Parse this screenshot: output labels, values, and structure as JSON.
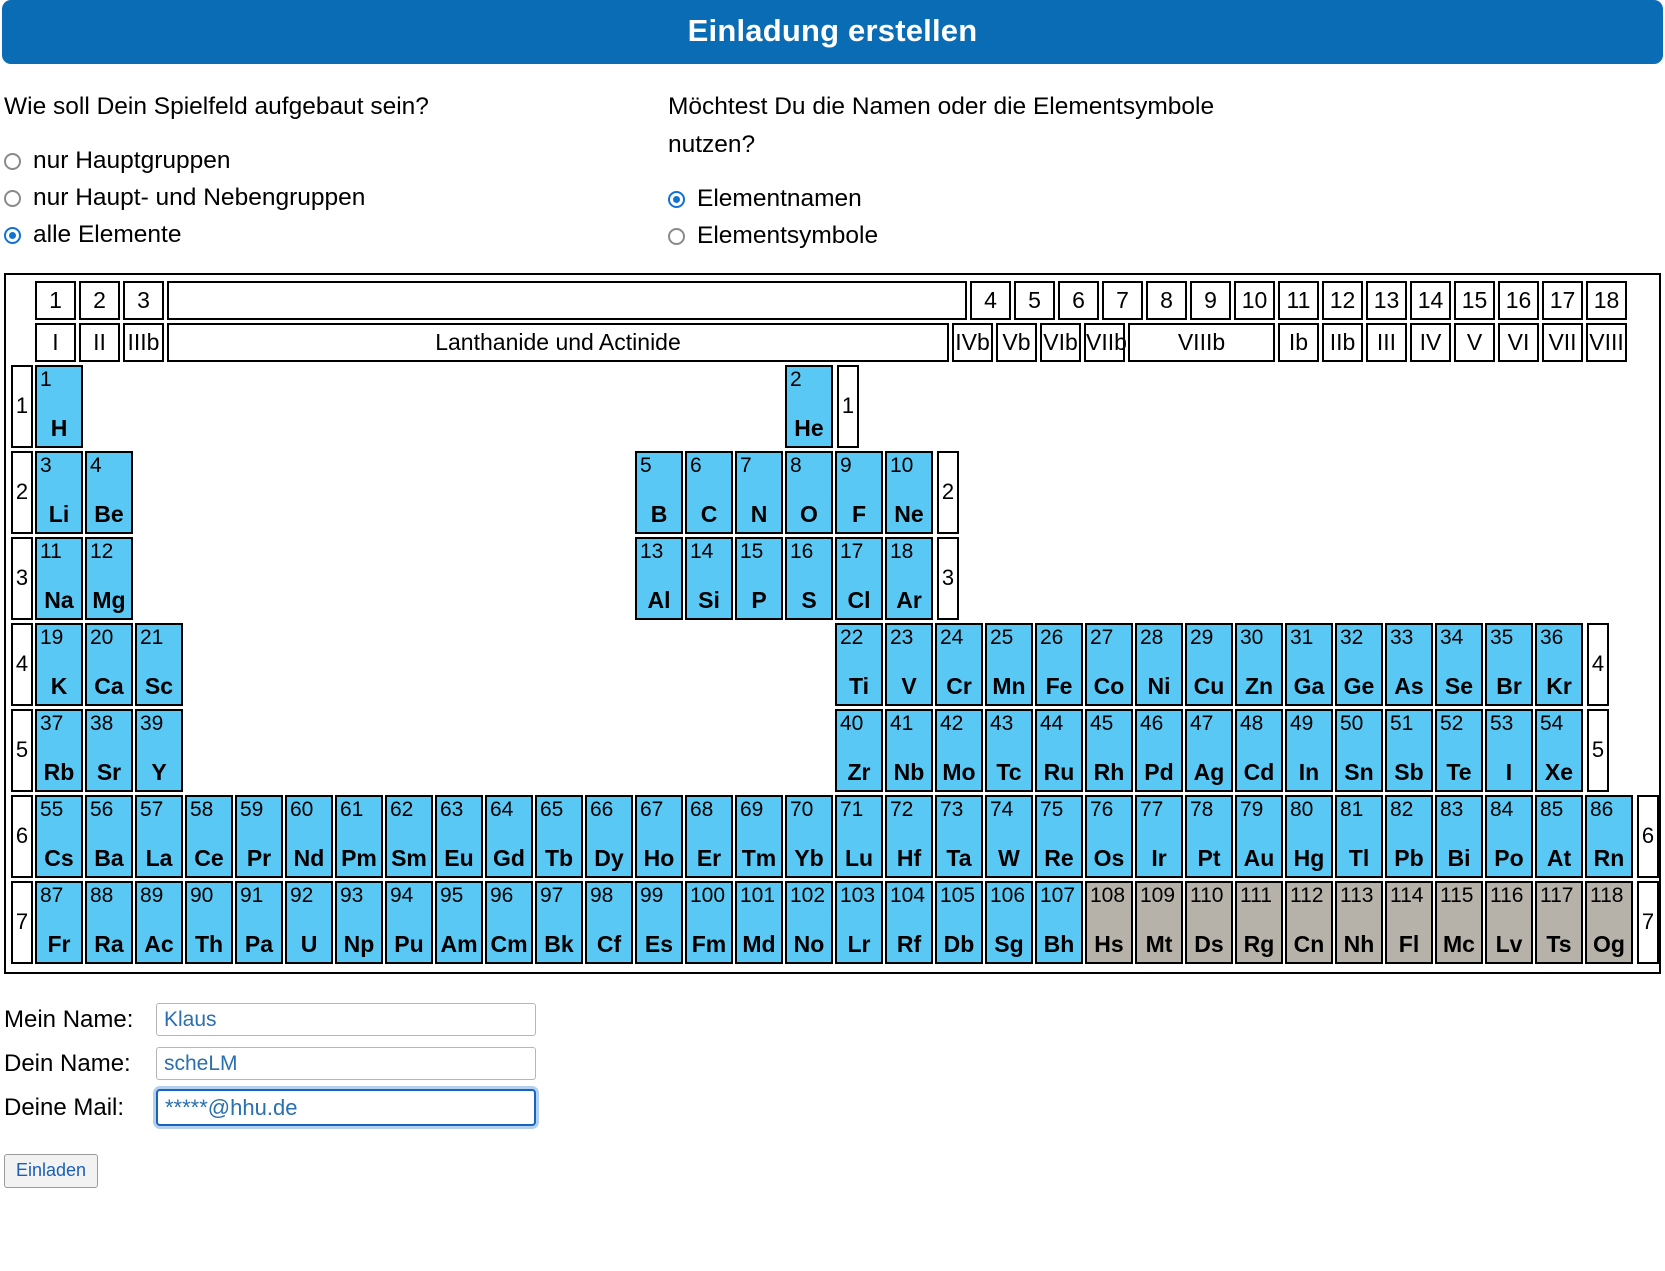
{
  "header": {
    "title": "Einladung erstellen",
    "accent": "#0a6cb4"
  },
  "questions": {
    "layout": {
      "prompt": "Wie soll Dein Spielfeld aufgebaut sein?",
      "options": [
        {
          "label": "nur Hauptgruppen",
          "selected": false
        },
        {
          "label": "nur Haupt- und Nebengruppen",
          "selected": false
        },
        {
          "label": "alle Elemente",
          "selected": true
        }
      ]
    },
    "naming": {
      "prompt": "Möchtest Du die Namen oder die Elementsymbole nutzen?",
      "options": [
        {
          "label": "Elementnamen",
          "selected": true
        },
        {
          "label": "Elementsymbole",
          "selected": false
        }
      ]
    }
  },
  "periodic_table": {
    "colors": {
      "element": "#5ac8f5",
      "disabled": "#b6b2aa",
      "border": "#000000"
    },
    "group_numbers_left": [
      "1",
      "2",
      "3"
    ],
    "group_numbers_right": [
      "4",
      "5",
      "6",
      "7",
      "8",
      "9",
      "10",
      "11",
      "12",
      "13",
      "14",
      "15",
      "16",
      "17",
      "18"
    ],
    "roman_left": [
      "I",
      "II",
      "IIIb"
    ],
    "lanthanide_label": "Lanthanide und Actinide",
    "roman_right": [
      "IVb",
      "Vb",
      "VIb",
      "VIIb",
      "VIIIb",
      "Ib",
      "IIb",
      "III",
      "IV",
      "V",
      "VI",
      "VII",
      "VIII"
    ],
    "period_labels": [
      "1",
      "2",
      "3",
      "4",
      "5",
      "6",
      "7"
    ],
    "rows": [
      {
        "period": "1",
        "left": [
          {
            "n": "1",
            "s": "H"
          }
        ],
        "gap": 14,
        "right": [
          {
            "n": "2",
            "s": "He"
          }
        ]
      },
      {
        "period": "2",
        "left": [
          {
            "n": "3",
            "s": "Li"
          },
          {
            "n": "4",
            "s": "Be"
          }
        ],
        "gap": 10,
        "right": [
          {
            "n": "5",
            "s": "B"
          },
          {
            "n": "6",
            "s": "C"
          },
          {
            "n": "7",
            "s": "N"
          },
          {
            "n": "8",
            "s": "O"
          },
          {
            "n": "9",
            "s": "F"
          },
          {
            "n": "10",
            "s": "Ne"
          }
        ]
      },
      {
        "period": "3",
        "left": [
          {
            "n": "11",
            "s": "Na"
          },
          {
            "n": "12",
            "s": "Mg"
          }
        ],
        "gap": 10,
        "right": [
          {
            "n": "13",
            "s": "Al"
          },
          {
            "n": "14",
            "s": "Si"
          },
          {
            "n": "15",
            "s": "P"
          },
          {
            "n": "16",
            "s": "S"
          },
          {
            "n": "17",
            "s": "Cl"
          },
          {
            "n": "18",
            "s": "Ar"
          }
        ]
      },
      {
        "period": "4",
        "left": [
          {
            "n": "19",
            "s": "K"
          },
          {
            "n": "20",
            "s": "Ca"
          },
          {
            "n": "21",
            "s": "Sc"
          }
        ],
        "gap": 13,
        "right": [
          {
            "n": "22",
            "s": "Ti"
          },
          {
            "n": "23",
            "s": "V"
          },
          {
            "n": "24",
            "s": "Cr"
          },
          {
            "n": "25",
            "s": "Mn"
          },
          {
            "n": "26",
            "s": "Fe"
          },
          {
            "n": "27",
            "s": "Co"
          },
          {
            "n": "28",
            "s": "Ni"
          },
          {
            "n": "29",
            "s": "Cu"
          },
          {
            "n": "30",
            "s": "Zn"
          },
          {
            "n": "31",
            "s": "Ga"
          },
          {
            "n": "32",
            "s": "Ge"
          },
          {
            "n": "33",
            "s": "As"
          },
          {
            "n": "34",
            "s": "Se"
          },
          {
            "n": "35",
            "s": "Br"
          },
          {
            "n": "36",
            "s": "Kr"
          }
        ]
      },
      {
        "period": "5",
        "left": [
          {
            "n": "37",
            "s": "Rb"
          },
          {
            "n": "38",
            "s": "Sr"
          },
          {
            "n": "39",
            "s": "Y"
          }
        ],
        "gap": 13,
        "right": [
          {
            "n": "40",
            "s": "Zr"
          },
          {
            "n": "41",
            "s": "Nb"
          },
          {
            "n": "42",
            "s": "Mo"
          },
          {
            "n": "43",
            "s": "Tc"
          },
          {
            "n": "44",
            "s": "Ru"
          },
          {
            "n": "45",
            "s": "Rh"
          },
          {
            "n": "46",
            "s": "Pd"
          },
          {
            "n": "47",
            "s": "Ag"
          },
          {
            "n": "48",
            "s": "Cd"
          },
          {
            "n": "49",
            "s": "In"
          },
          {
            "n": "50",
            "s": "Sn"
          },
          {
            "n": "51",
            "s": "Sb"
          },
          {
            "n": "52",
            "s": "Te"
          },
          {
            "n": "53",
            "s": "I"
          },
          {
            "n": "54",
            "s": "Xe"
          }
        ]
      },
      {
        "period": "6",
        "left": [
          {
            "n": "55",
            "s": "Cs"
          },
          {
            "n": "56",
            "s": "Ba"
          },
          {
            "n": "57",
            "s": "La"
          },
          {
            "n": "58",
            "s": "Ce"
          },
          {
            "n": "59",
            "s": "Pr"
          },
          {
            "n": "60",
            "s": "Nd"
          },
          {
            "n": "61",
            "s": "Pm"
          },
          {
            "n": "62",
            "s": "Sm"
          },
          {
            "n": "63",
            "s": "Eu"
          },
          {
            "n": "64",
            "s": "Gd"
          },
          {
            "n": "65",
            "s": "Tb"
          },
          {
            "n": "66",
            "s": "Dy"
          },
          {
            "n": "67",
            "s": "Ho"
          },
          {
            "n": "68",
            "s": "Er"
          },
          {
            "n": "69",
            "s": "Tm"
          },
          {
            "n": "70",
            "s": "Yb"
          },
          {
            "n": "71",
            "s": "Lu"
          }
        ],
        "gap": 0,
        "right": [
          {
            "n": "72",
            "s": "Hf"
          },
          {
            "n": "73",
            "s": "Ta"
          },
          {
            "n": "74",
            "s": "W"
          },
          {
            "n": "75",
            "s": "Re"
          },
          {
            "n": "76",
            "s": "Os"
          },
          {
            "n": "77",
            "s": "Ir"
          },
          {
            "n": "78",
            "s": "Pt"
          },
          {
            "n": "79",
            "s": "Au"
          },
          {
            "n": "80",
            "s": "Hg"
          },
          {
            "n": "81",
            "s": "Tl"
          },
          {
            "n": "82",
            "s": "Pb"
          },
          {
            "n": "83",
            "s": "Bi"
          },
          {
            "n": "84",
            "s": "Po"
          },
          {
            "n": "85",
            "s": "At"
          },
          {
            "n": "86",
            "s": "Rn"
          }
        ]
      },
      {
        "period": "7",
        "left": [
          {
            "n": "87",
            "s": "Fr"
          },
          {
            "n": "88",
            "s": "Ra"
          },
          {
            "n": "89",
            "s": "Ac"
          },
          {
            "n": "90",
            "s": "Th"
          },
          {
            "n": "91",
            "s": "Pa"
          },
          {
            "n": "92",
            "s": "U"
          },
          {
            "n": "93",
            "s": "Np"
          },
          {
            "n": "94",
            "s": "Pu"
          },
          {
            "n": "95",
            "s": "Am"
          },
          {
            "n": "96",
            "s": "Cm"
          },
          {
            "n": "97",
            "s": "Bk"
          },
          {
            "n": "98",
            "s": "Cf"
          },
          {
            "n": "99",
            "s": "Es"
          },
          {
            "n": "100",
            "s": "Fm"
          },
          {
            "n": "101",
            "s": "Md"
          },
          {
            "n": "102",
            "s": "No"
          },
          {
            "n": "103",
            "s": "Lr"
          }
        ],
        "gap": 0,
        "right": [
          {
            "n": "104",
            "s": "Rf"
          },
          {
            "n": "105",
            "s": "Db"
          },
          {
            "n": "106",
            "s": "Sg"
          },
          {
            "n": "107",
            "s": "Bh"
          },
          {
            "n": "108",
            "s": "Hs",
            "disabled": true
          },
          {
            "n": "109",
            "s": "Mt",
            "disabled": true
          },
          {
            "n": "110",
            "s": "Ds",
            "disabled": true
          },
          {
            "n": "111",
            "s": "Rg",
            "disabled": true
          },
          {
            "n": "112",
            "s": "Cn",
            "disabled": true
          },
          {
            "n": "113",
            "s": "Nh",
            "disabled": true
          },
          {
            "n": "114",
            "s": "Fl",
            "disabled": true
          },
          {
            "n": "115",
            "s": "Mc",
            "disabled": true
          },
          {
            "n": "116",
            "s": "Lv",
            "disabled": true
          },
          {
            "n": "117",
            "s": "Ts",
            "disabled": true
          },
          {
            "n": "118",
            "s": "Og",
            "disabled": true
          }
        ]
      }
    ]
  },
  "form": {
    "fields": [
      {
        "label": "Mein Name:",
        "value": "Klaus",
        "placeholder": "",
        "focused": false
      },
      {
        "label": "Dein Name:",
        "value": "scheLM",
        "placeholder": "",
        "focused": false
      },
      {
        "label": "Deine Mail:",
        "value": "*****@hhu.de",
        "placeholder": "",
        "focused": true
      }
    ],
    "submit_label": "Einladen"
  }
}
